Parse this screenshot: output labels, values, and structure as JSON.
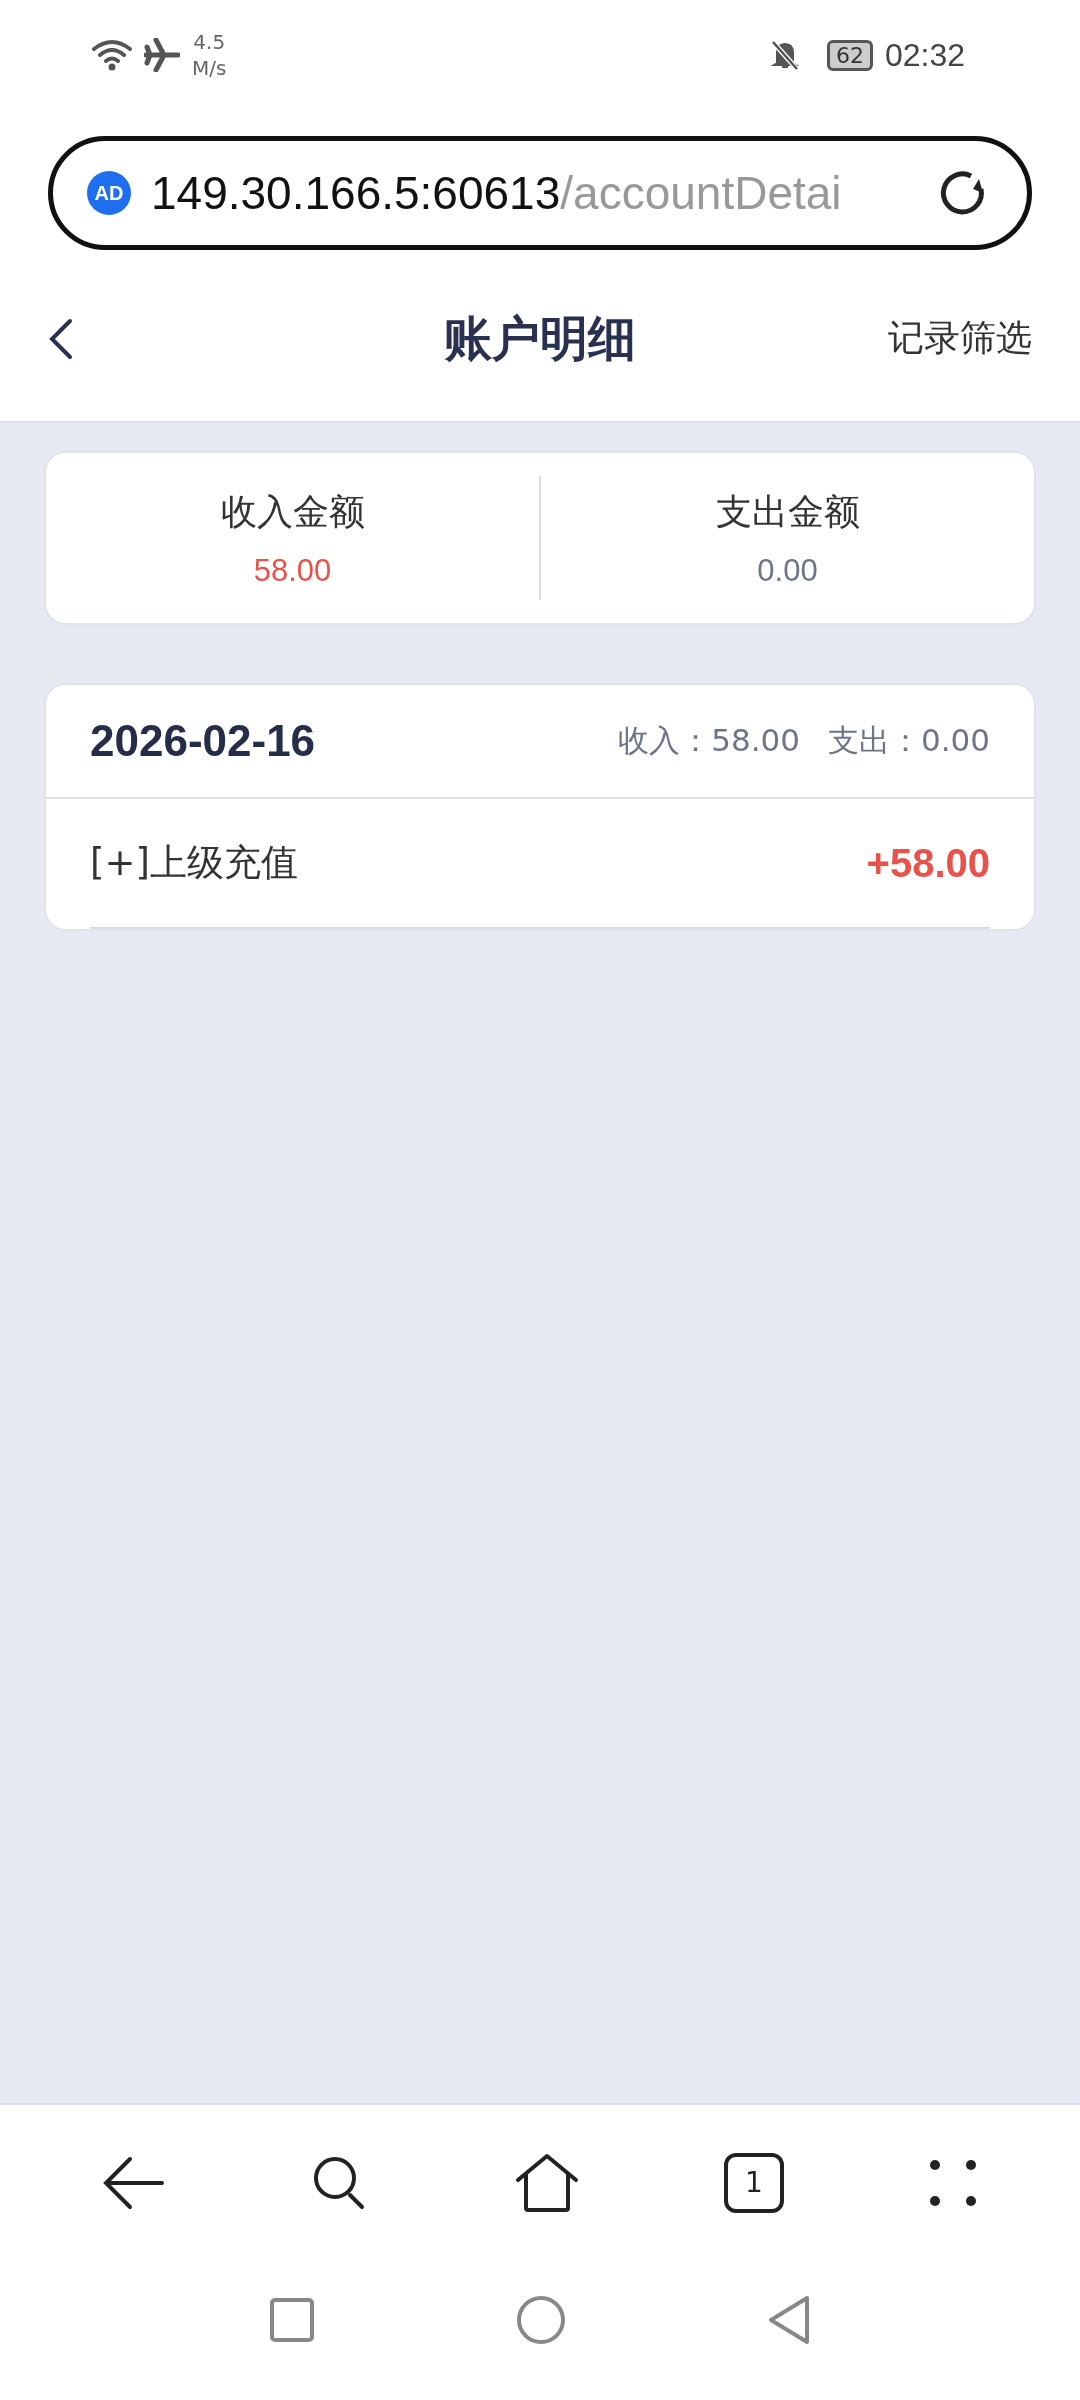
{
  "status_bar": {
    "speed_value": "4.5",
    "speed_unit": "M/s",
    "battery": "62",
    "time": "02:32"
  },
  "address_bar": {
    "badge": "AD",
    "host": "149.30.166.5:60613",
    "path": "/accountDetai"
  },
  "header": {
    "title": "账户明细",
    "action": "记录筛选"
  },
  "summary": [
    {
      "label": "收入金额",
      "amount": "58.00",
      "kind": "income"
    },
    {
      "label": "支出金额",
      "amount": "0.00",
      "kind": "expense"
    }
  ],
  "days": [
    {
      "date": "2026-02-16",
      "income": "收入：58.00",
      "expense": "支出：0.00",
      "records": [
        {
          "title": "[+]上级充值",
          "amount": "+58.00",
          "kind": "income"
        }
      ]
    }
  ],
  "browser_toolbar": {
    "tab_count": "1"
  }
}
